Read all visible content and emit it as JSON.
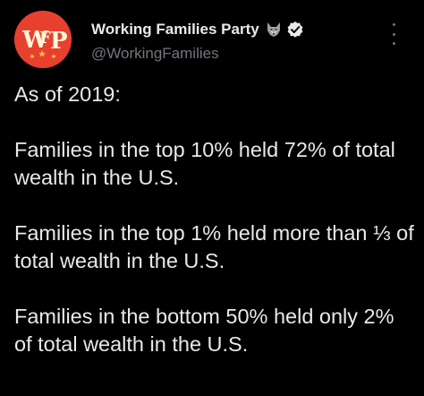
{
  "author": {
    "display_name": "Working Families Party",
    "emoji_icon": "wolf-emoji-icon",
    "verified_icon": "verified-badge-icon",
    "handle": "@WorkingFamilies",
    "avatar_text": "WFP",
    "avatar_color": "#e8402f"
  },
  "menu": {
    "icon": "more-options-icon"
  },
  "tweet": {
    "paragraphs": [
      "As of 2019:",
      "Families in the top 10% held 72% of total wealth in the U.S.",
      "Families in the top 1% held more than ⅓ of total wealth in the U.S.",
      "Families in the bottom 50% held only 2% of total wealth in the U.S."
    ]
  },
  "colors": {
    "background": "#000000",
    "text": "#e7e9ea",
    "secondary_text": "#71767b",
    "verified_badge": "#e7e9ea"
  }
}
